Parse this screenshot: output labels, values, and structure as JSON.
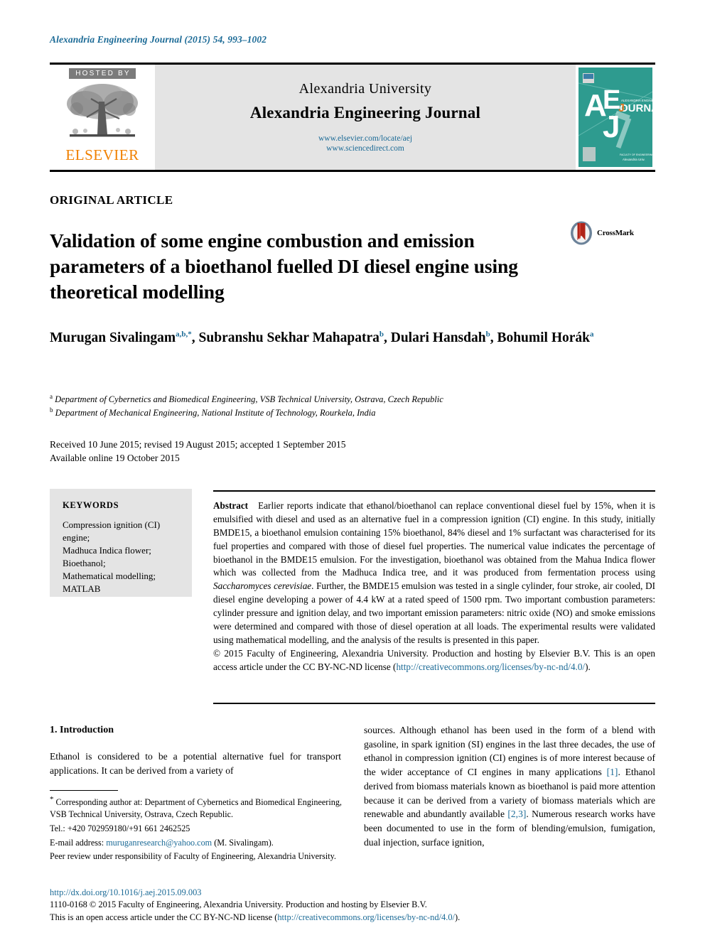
{
  "running_head": "Alexandria Engineering Journal (2015) 54, 993–1002",
  "banner": {
    "hosted_by": "HOSTED BY",
    "publisher_name": "ELSEVIER",
    "university": "Alexandria University",
    "journal": "Alexandria Engineering Journal",
    "url_locate": "www.elsevier.com/locate/aej",
    "url_sciencedirect": "www.sciencedirect.com",
    "cover": {
      "letters": "AEJ",
      "word": "JOURNAL",
      "small_title": "ALEXANDRIA ENGINEERING",
      "bg_color": "#2e9b8f"
    }
  },
  "article": {
    "type": "ORIGINAL ARTICLE",
    "title": "Validation of some engine combustion and emission parameters of a bioethanol fuelled DI diesel engine using theoretical modelling",
    "crossmark_label": "CrossMark"
  },
  "authors": {
    "list": [
      {
        "name": "Murugan Sivalingam",
        "marks": "a,b,*"
      },
      {
        "name": "Subranshu Sekhar Mahapatra",
        "marks": "b"
      },
      {
        "name": "Dulari Hansdah",
        "marks": "b"
      },
      {
        "name": "Bohumil Horák",
        "marks": "a"
      }
    ],
    "affiliations": [
      {
        "mark": "a",
        "text": "Department of Cybernetics and Biomedical Engineering, VSB Technical University, Ostrava, Czech Republic"
      },
      {
        "mark": "b",
        "text": "Department of Mechanical Engineering, National Institute of Technology, Rourkela, India"
      }
    ]
  },
  "dates": {
    "line1": "Received 10 June 2015; revised 19 August 2015; accepted 1 September 2015",
    "line2": "Available online 19 October 2015"
  },
  "keywords": {
    "heading": "KEYWORDS",
    "items": "Compression ignition (CI) engine;\nMadhuca Indica flower;\nBioethanol;\nMathematical modelling;\nMATLAB"
  },
  "abstract": {
    "label": "Abstract",
    "p1_a": "Earlier reports indicate that ethanol/bioethanol can replace conventional diesel fuel by 15%, when it is emulsified with diesel and used as an alternative fuel in a compression ignition (CI) engine. In this study, initially BMDE15, a bioethanol emulsion containing 15% bioethanol, 84% diesel and 1% surfactant was characterised for its fuel properties and compared with those of diesel fuel properties. The numerical value indicates the percentage of bioethanol in the BMDE15 emulsion. For the investigation, bioethanol was obtained from the Mahua Indica flower which was collected from the Madhuca Indica tree, and it was produced from fermentation process using ",
    "p1_italic": "Saccharomyces cerevisiae",
    "p1_b": ". Further, the BMDE15 emulsion was tested in a single cylinder, four stroke, air cooled, DI diesel engine developing a power of 4.4 kW at a rated speed of 1500 rpm. Two important combustion parameters: cylinder pressure and ignition delay, and two important emission parameters: nitric oxide (NO) and smoke emissions were determined and compared with those of diesel operation at all loads. The experimental results were validated using mathematical modelling, and the analysis of the results is presented in this paper.",
    "copyright_a": "© 2015 Faculty of Engineering, Alexandria University. Production and hosting by Elsevier B.V. This is an open access article under the CC BY-NC-ND license (",
    "copyright_link": "http://creativecommons.org/licenses/by-nc-nd/4.0/",
    "copyright_b": ")."
  },
  "introduction": {
    "heading": "1. Introduction",
    "left_text": "Ethanol is considered to be a potential alternative fuel for transport applications. It can be derived from a variety of",
    "right_a": "sources. Although ethanol has been used in the form of a blend with gasoline, in spark ignition (SI) engines in the last three decades, the use of ethanol in compression ignition (CI) engines is of more interest because of the wider acceptance of CI engines in many applications ",
    "right_ref1": "[1]",
    "right_b": ". Ethanol derived from biomass materials known as bioethanol is paid more attention because it can be derived from a variety of biomass materials which are renewable and abundantly available ",
    "right_ref2": "[2,3]",
    "right_c": ". Numerous research works have been documented to use in the form of blending/emulsion, fumigation, dual injection, surface ignition,"
  },
  "footnote": {
    "corresponding_star": "*",
    "corresponding": "Corresponding author at: Department of Cybernetics and Biomedical Engineering, VSB Technical University, Ostrava, Czech Republic.",
    "tel": "Tel.: +420 702959180/+91 661 2462525",
    "email_label": "E-mail address:",
    "email": "muruganresearch@yahoo.com",
    "email_suffix": "(M. Sivalingam).",
    "peer_review": "Peer review under responsibility of Faculty of Engineering, Alexandria University."
  },
  "page_footer": {
    "doi": "http://dx.doi.org/10.1016/j.aej.2015.09.003",
    "issn_line": "1110-0168 © 2015 Faculty of Engineering, Alexandria University. Production and hosting by Elsevier B.V.",
    "license_a": "This is an open access article under the CC BY-NC-ND license (",
    "license_link": "http://creativecommons.org/licenses/by-nc-nd/4.0/",
    "license_b": ")."
  },
  "colors": {
    "link": "#1b6a96",
    "elsevier_orange": "#F08000",
    "hosted_gray": "#7b7b7b",
    "banner_gray": "#e4e4e4"
  }
}
